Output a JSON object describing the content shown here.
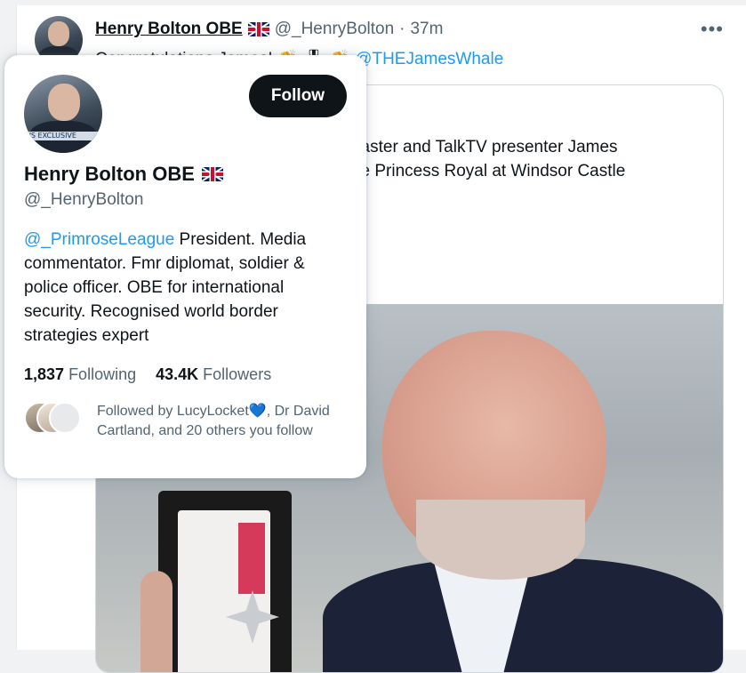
{
  "tweet": {
    "author_name": "Henry Bolton OBE",
    "handle": "@_HenryBolton",
    "separator": "·",
    "time": "37m",
    "more_label": "•••",
    "text_start": "Congratulations James!",
    "text_emojis": "👏 🎖 👏",
    "mention": "@THEJamesWhale",
    "card_lines": [
      "roadcaster and TalkTV presenter James",
      "om the Princess Royal at Windsor Castle"
    ]
  },
  "hovercard": {
    "name": "Henry Bolton OBE",
    "handle": "@_HenryBolton",
    "follow_label": "Follow",
    "avatar_banner": "WS EXCLUSIVE",
    "bio_mention": "@_PrimroseLeague",
    "bio_text": " President. Media commentator. Fmr diplomat, soldier & police officer. OBE for international security. Recognised world border strategies expert",
    "following_count": "1,837",
    "following_label": "Following",
    "followers_count": "43.4K",
    "followers_label": "Followers",
    "followed_by_prefix": "Followed by LucyLocket",
    "followed_by_heart": "💙",
    "followed_by_rest": ", Dr David Cartland, and 20 others you follow"
  },
  "colors": {
    "link": "#1d9bf0",
    "text": "#0f1419",
    "secondary": "#536471",
    "follow_button_bg": "#0f1419"
  },
  "icons": {
    "flag": "uk-flag-icon",
    "more": "more-options-icon"
  }
}
